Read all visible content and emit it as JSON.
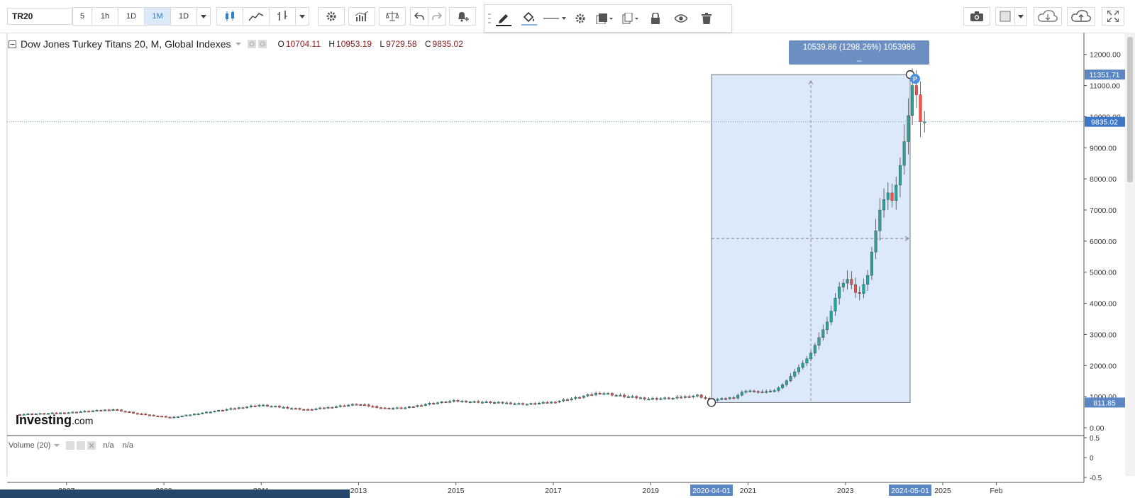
{
  "toolbar": {
    "symbol": "TR20",
    "intervals": [
      "5",
      "1h",
      "1D",
      "1M",
      "1D"
    ],
    "active_interval": "1M"
  },
  "chart": {
    "title": "Dow Jones Turkey Titans 20, M, Global Indexes",
    "ohlc": {
      "o_label": "O",
      "o": "10704.11",
      "h_label": "H",
      "h": "10953.19",
      "l_label": "L",
      "l": "9729.58",
      "c_label": "C",
      "c": "9835.02"
    },
    "measure_label": "10539.86 (1298.26%) 1053986",
    "measure_label_line2": "_",
    "logo_main": "Investing",
    "logo_suffix": ".com",
    "volume_label": "Volume (20)",
    "volume_values": [
      "n/a",
      "n/a"
    ],
    "price_labels": {
      "top": "11351.71",
      "current": "9835.02",
      "bottom": "811.85"
    },
    "date_labels": {
      "start": "2020-04-01",
      "end": "2024-05-01"
    },
    "marker_label": "P",
    "colors": {
      "up": "#26a69a",
      "down": "#ef5350",
      "selection": "#dbe9fb",
      "accent": "#4a90e2"
    }
  },
  "chart_data": {
    "type": "candlestick",
    "title": "Dow Jones Turkey Titans 20, M, Global Indexes",
    "xlabel": "",
    "ylabel": "",
    "ylim": [
      -250,
      12700
    ],
    "y_ticks": [
      "12000.00",
      "11000.00",
      "10000.00",
      "9000.00",
      "8000.00",
      "7000.00",
      "6000.00",
      "5000.00",
      "4000.00",
      "3000.00",
      "2000.00",
      "1000.00",
      "0.00"
    ],
    "y_tick_values": [
      12000,
      11000,
      10000,
      9000,
      8000,
      7000,
      6000,
      5000,
      4000,
      3000,
      2000,
      1000,
      0
    ],
    "x_ticks": [
      "2007",
      "2009",
      "2011",
      "2013",
      "2015",
      "2017",
      "2019",
      "2021",
      "2023",
      "2025",
      "Feb"
    ],
    "x_tick_values": [
      2007.0,
      2009.0,
      2011.0,
      2013.0,
      2015.0,
      2017.0,
      2019.0,
      2021.0,
      2023.0,
      2025.0,
      2026.1
    ],
    "x_range": [
      2005.78,
      2027.9
    ],
    "volume_ticks": [
      "0.5",
      "0",
      "-0.5"
    ],
    "measure": {
      "x_start": 2020.25,
      "x_end": 2024.33,
      "y_low": 811.85,
      "y_high": 11351.71,
      "change": "10539.86",
      "percent": "1298.26%"
    },
    "current_price": 9835.02,
    "anchors": [
      [
        2006.0,
        430
      ],
      [
        2007.0,
        480
      ],
      [
        2008.0,
        590
      ],
      [
        2008.5,
        450
      ],
      [
        2009.2,
        330
      ],
      [
        2010.0,
        520
      ],
      [
        2011.0,
        730
      ],
      [
        2012.0,
        580
      ],
      [
        2013.0,
        760
      ],
      [
        2013.6,
        620
      ],
      [
        2014.0,
        640
      ],
      [
        2014.5,
        780
      ],
      [
        2015.0,
        860
      ],
      [
        2016.0,
        800
      ],
      [
        2016.5,
        760
      ],
      [
        2017.0,
        820
      ],
      [
        2017.5,
        960
      ],
      [
        2018.0,
        1130
      ],
      [
        2018.5,
        1010
      ],
      [
        2019.0,
        930
      ],
      [
        2019.5,
        950
      ],
      [
        2020.0,
        1040
      ],
      [
        2020.25,
        900
      ],
      [
        2020.5,
        920
      ],
      [
        2020.75,
        980
      ],
      [
        2021.0,
        1200
      ],
      [
        2021.3,
        1150
      ],
      [
        2021.6,
        1200
      ],
      [
        2021.8,
        1450
      ],
      [
        2022.0,
        1800
      ],
      [
        2022.3,
        2300
      ],
      [
        2022.5,
        2900
      ],
      [
        2022.7,
        3500
      ],
      [
        2022.9,
        4500
      ],
      [
        2023.1,
        4800
      ],
      [
        2023.3,
        4200
      ],
      [
        2023.5,
        4900
      ],
      [
        2023.6,
        5800
      ],
      [
        2023.75,
        7000
      ],
      [
        2023.9,
        7600
      ],
      [
        2024.0,
        7300
      ],
      [
        2024.1,
        7900
      ],
      [
        2024.2,
        8700
      ],
      [
        2024.35,
        10200
      ],
      [
        2024.45,
        11400
      ],
      [
        2024.5,
        10704
      ],
      [
        2024.55,
        9835
      ]
    ]
  }
}
